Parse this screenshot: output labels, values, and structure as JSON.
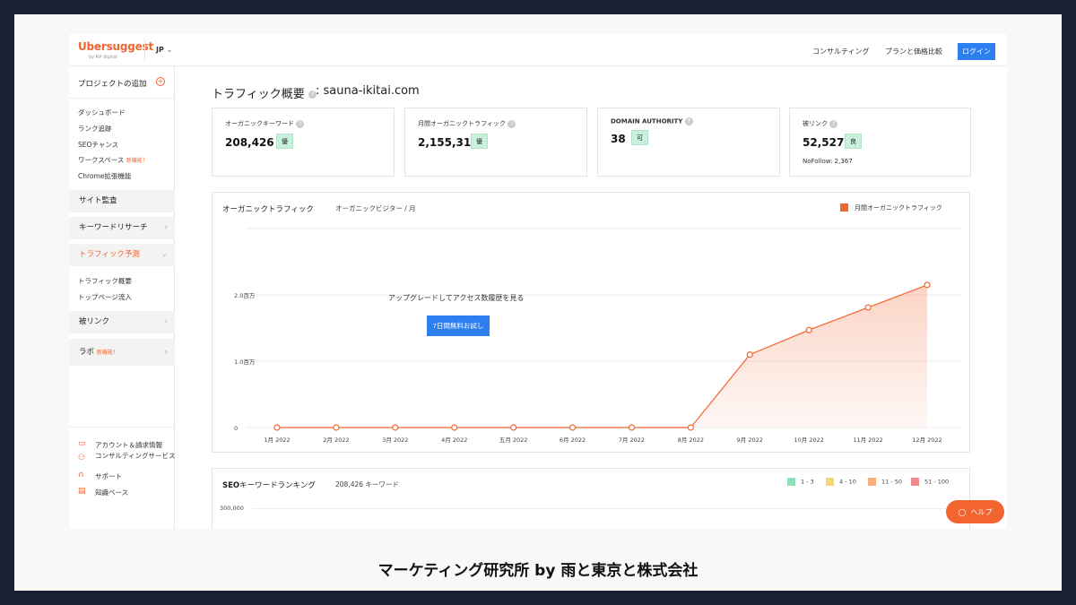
{
  "header": {
    "logo": "Ubersuggest",
    "logo_sub": "by NP digital",
    "lang": "JP",
    "nav": [
      "コンサルティング",
      "プランと価格比較"
    ],
    "login": "ログイン"
  },
  "sidebar": {
    "add_project": "プロジェクトの追加",
    "items": [
      "ダッシュボード",
      "ランク追跡",
      "SEOチャンス",
      "ワークスペース",
      "Chrome拡張機能"
    ],
    "new_badge": "新機能！",
    "site_audit": "サイト監査",
    "keyword_research": "キーワードリサーチ",
    "traffic_forecast": "トラフィック予測",
    "traffic_sub": [
      "トラフィック概要",
      "トップページ流入"
    ],
    "backlinks": "被リンク",
    "labs": "ラボ",
    "labs_badge": "新機能！",
    "footer": [
      "アカウント＆請求情報",
      "コンサルティングサービス",
      "サポート",
      "知識ベース"
    ]
  },
  "page": {
    "title": "トラフィック概要",
    "domain": ": sauna-ikitai.com"
  },
  "cards": [
    {
      "label": "オーガニックキーワード",
      "value": "208,426",
      "badge": "優"
    },
    {
      "label": "月間オーガニックトラフィック",
      "value": "2,155,317",
      "badge": "優"
    },
    {
      "label": "DOMAIN AUTHORITY",
      "value": "38",
      "badge": "可"
    },
    {
      "label": "被リンク",
      "value": "52,527",
      "badge": "良",
      "note": "NoFollow: 2,367"
    }
  ],
  "chart": {
    "title": "オーガニックトラフィック",
    "subtitle": "オーガニックビジター / 月",
    "upgrade_text": "アップグレードしてアクセス数履歴を見る",
    "trial_button": "7日間無料お試し"
  },
  "chart_data": {
    "type": "area",
    "x": [
      "1月 2022",
      "2月 2022",
      "3月 2022",
      "4月 2022",
      "五月 2022",
      "6月 2022",
      "7月 2022",
      "8月 2022",
      "9月 2022",
      "10月 2022",
      "11月 2022",
      "12月 2022"
    ],
    "series": [
      {
        "name": "月間オーガニックトラフィック",
        "values": [
          0,
          0,
          0,
          0,
          0,
          0,
          0,
          0,
          1100000,
          1470000,
          1810000,
          2150000
        ]
      }
    ],
    "y_ticks": [
      "0",
      "1.0百万",
      "2.0百万"
    ],
    "ylim": [
      0,
      3000000
    ],
    "color": "#f26430",
    "legend": "top-right",
    "grid": true
  },
  "ranking": {
    "title_bold": "SEO",
    "title_rest": "キーワードランキング",
    "subtitle": "208,426 キーワード",
    "legend": [
      {
        "label": "1 - 3",
        "color": "#8ee0b8"
      },
      {
        "label": "4 - 10",
        "color": "#f9d66b"
      },
      {
        "label": "11 - 50",
        "color": "#f6b07e"
      },
      {
        "label": "51 - 100",
        "color": "#f28b8b"
      }
    ],
    "ytick": "300,000"
  },
  "help": "ヘルプ",
  "footer_caption": "マーケティング研究所 by 雨と東京と株式会社"
}
